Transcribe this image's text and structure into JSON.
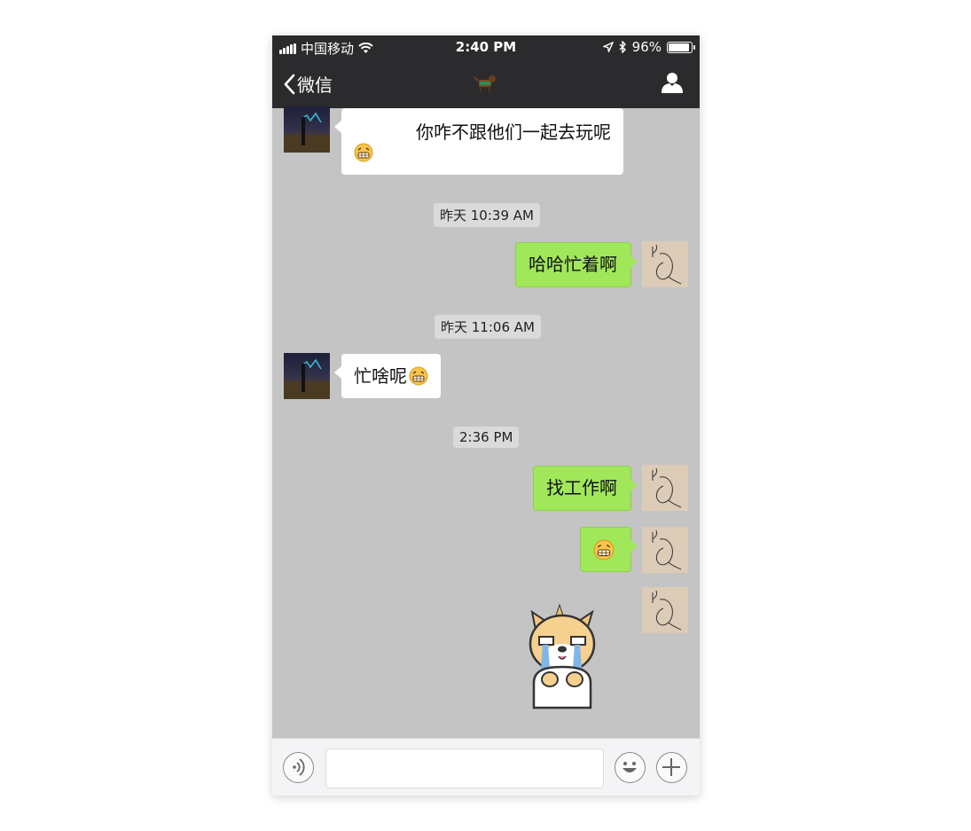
{
  "status_bar": {
    "carrier": "中国移动",
    "time": "2:40 PM",
    "battery_percent": "96%",
    "battery_level": 0.96,
    "icons": [
      "signal-icon",
      "wifi-icon",
      "location-arrow-icon",
      "bluetooth-icon",
      "battery-icon"
    ]
  },
  "nav": {
    "back_label": "微信",
    "title_icon": "dog-avatar-icon",
    "right_icon": "person-icon"
  },
  "messages": {
    "m1": {
      "text": "你咋不跟他们一起去玩呢",
      "emoji": "grin-emoji",
      "side": "left"
    },
    "ts1": "昨天 10:39 AM",
    "m2": {
      "text": "哈哈忙着啊",
      "side": "right"
    },
    "ts2": "昨天 11:06 AM",
    "m3": {
      "text": "忙啥呢",
      "emoji": "grin-emoji",
      "side": "left"
    },
    "ts3": "2:36 PM",
    "m4": {
      "text": "找工作啊",
      "side": "right"
    },
    "m5": {
      "emoji": "grin-emoji",
      "side": "right"
    },
    "m6": {
      "sticker": "crying-dog-sticker",
      "side": "right"
    }
  },
  "input_bar": {
    "voice_icon": "voice-icon",
    "text_value": "",
    "emoji_icon": "smiley-icon",
    "plus_icon": "plus-icon"
  },
  "colors": {
    "nav_bg": "#2b2b2d",
    "chat_bg": "#c4c4c4",
    "sent_bubble": "#a0e75a",
    "received_bubble": "#ffffff",
    "timestamp_bg": "#dadada"
  }
}
